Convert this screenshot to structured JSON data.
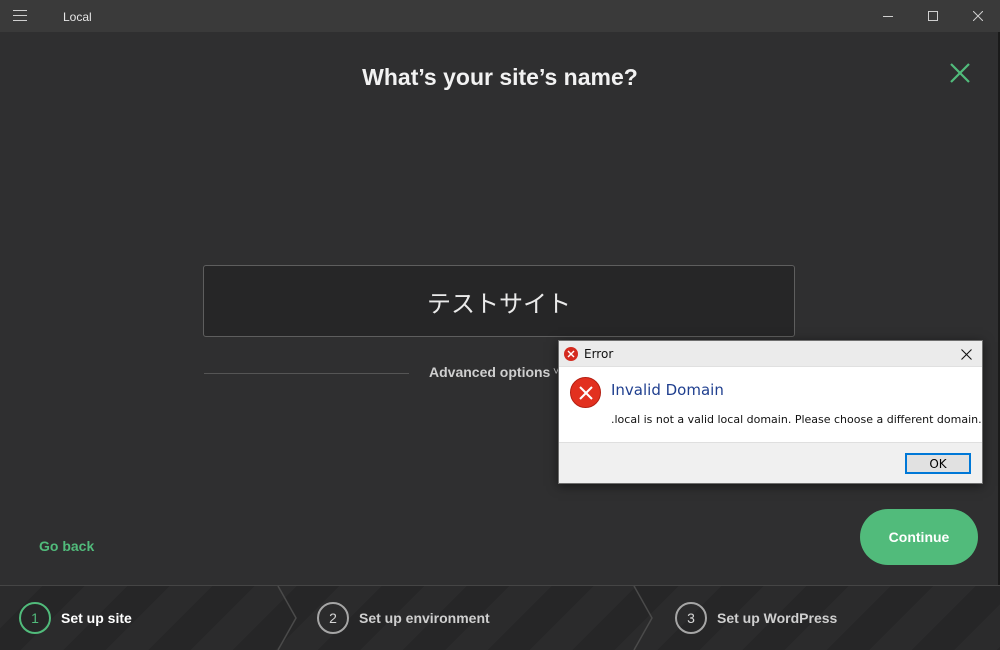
{
  "window": {
    "app_title": "Local",
    "menu_icon": "hamburger-icon",
    "minimize_icon": "minimize-icon",
    "maximize_icon": "maximize-icon",
    "close_icon": "close-icon"
  },
  "main": {
    "title": "What’s your site’s name?",
    "close_icon": "close-icon",
    "site_name_value": "テストサイト",
    "advanced_options_label": "Advanced options",
    "advanced_chevron": "˅",
    "go_back_label": "Go back",
    "continue_label": "Continue"
  },
  "steps": [
    {
      "number": "1",
      "label": "Set up site",
      "active": true
    },
    {
      "number": "2",
      "label": "Set up environment",
      "active": false
    },
    {
      "number": "3",
      "label": "Set up WordPress",
      "active": false
    }
  ],
  "dialog": {
    "title": "Error",
    "heading": "Invalid Domain",
    "message": ".local is not a valid local domain. Please choose a different domain.",
    "ok_label": "OK",
    "icon": "error-icon"
  },
  "colors": {
    "accent": "#51bb7b",
    "background": "#2f2f30",
    "error_red": "#e2301f",
    "dialog_heading": "#1f3f8f"
  }
}
